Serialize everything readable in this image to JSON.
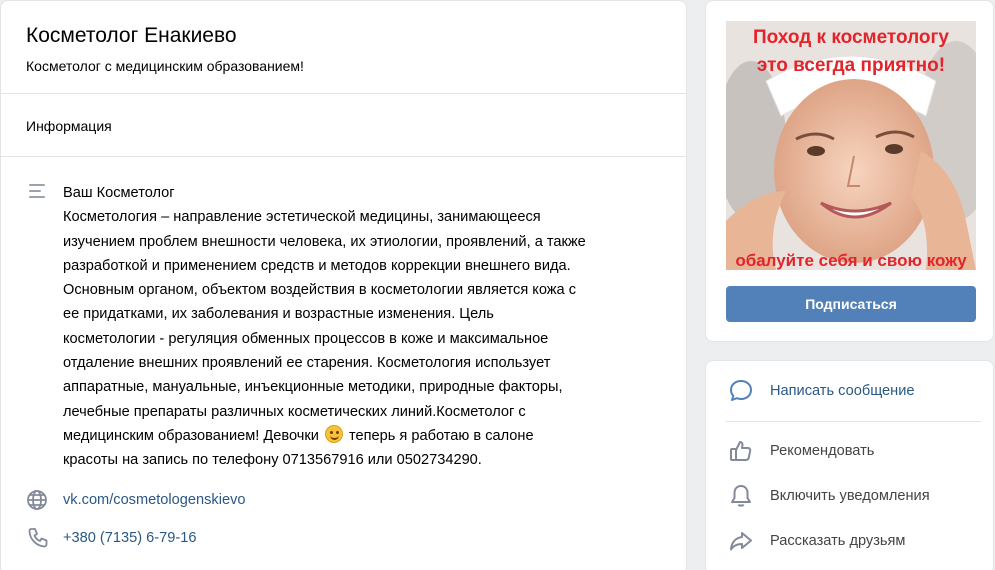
{
  "group": {
    "title": "Косметолог Енакиево",
    "status": "Косметолог с медицинским образованием!"
  },
  "tabs": {
    "info_label": "Информация"
  },
  "description": {
    "lines": [
      "Ваш Косметолог",
      "Косметология – направление эстетической медицины, занимающееся",
      "изучением проблем внешности человека, их этиологии, проявлений, а также",
      "разработкой и применением средств и методов коррекции внешнего вида.",
      "Основным органом, объектом воздействия в косметологии является кожа с",
      "ее придатками, их заболевания и возрастные изменения. Цель",
      "косметологии - регуляция обменных процессов в коже и максимальное",
      "отдаление внешних проявлений ее старения. Косметология использует",
      "аппаратные, мануальные, инъекционные методики, природные факторы,",
      "лечебные препараты различных косметических линий.Косметолог с"
    ],
    "line_with_emoji_before": "медицинским образованием! Девочки",
    "line_with_emoji_after": "теперь я работаю в салоне",
    "last_line": "красоты на запись по телефону 0713567916 или 0502734290."
  },
  "contacts": {
    "website": "vk.com/cosmetologenskievo",
    "phone": "+380 (7135) 6-79-16"
  },
  "cover": {
    "top_text_1": "Поход к косметологу",
    "top_text_2": "это всегда приятно!",
    "bottom_text": "обалуйте себя и свою кожу"
  },
  "sidebar": {
    "subscribe_label": "Подписаться",
    "actions": {
      "message": "Написать сообщение",
      "recommend": "Рекомендовать",
      "notifications": "Включить уведомления",
      "share": "Рассказать друзьям"
    }
  },
  "colors": {
    "accent": "#5181b8",
    "link": "#2a5885",
    "icon": "#828a99",
    "cover_text": "#e3242b"
  },
  "icons": [
    "lines-icon",
    "globe-icon",
    "phone-icon",
    "message-icon",
    "like-icon",
    "bell-icon",
    "share-icon",
    "smiley-emoji"
  ]
}
